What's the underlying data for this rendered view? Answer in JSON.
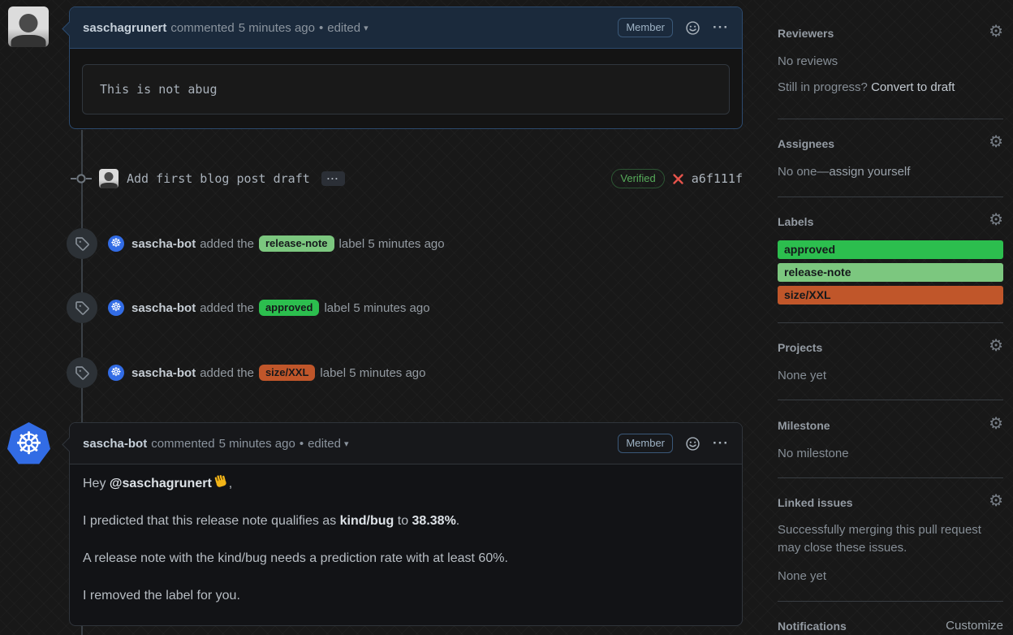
{
  "icons": {
    "kebab": "···",
    "gear": "⚙",
    "dropdown": "▾",
    "dot": "•",
    "wheel": "☸",
    "expand": "···"
  },
  "comment1": {
    "author": "saschagrunert",
    "action": "commented",
    "time": "5 minutes ago",
    "edited": "edited",
    "member_label": "Member",
    "code_text": "This is not abug"
  },
  "commit": {
    "message": "Add first blog post draft",
    "verified_label": "Verified",
    "sha": "a6f111f"
  },
  "events": [
    {
      "actor": "sascha-bot",
      "action": "added the",
      "label": "release-note",
      "label_color": "#7cc77f",
      "suffix": "label 5 minutes ago"
    },
    {
      "actor": "sascha-bot",
      "action": "added the",
      "label": "approved",
      "label_color": "#2cbe4e",
      "suffix": "label 5 minutes ago"
    },
    {
      "actor": "sascha-bot",
      "action": "added the",
      "label": "size/XXL",
      "label_color": "#c0562a",
      "suffix": "label 5 minutes ago"
    }
  ],
  "comment2": {
    "author": "sascha-bot",
    "action": "commented",
    "time": "5 minutes ago",
    "edited": "edited",
    "member_label": "Member",
    "p1_prefix": "Hey ",
    "p1_mention": "@saschagrunert",
    "p1_suffix": ",",
    "p2_prefix": "I predicted that this release note qualifies as ",
    "p2_bold1": "kind/bug",
    "p2_mid": " to ",
    "p2_bold2": "38.38%",
    "p2_suffix": ".",
    "p3": "A release note with the kind/bug needs a prediction rate with at least 60%.",
    "p4": "I removed the label for you."
  },
  "sidebar": {
    "reviewers": {
      "title": "Reviewers",
      "empty": "No reviews",
      "hint_prefix": "Still in progress? ",
      "hint_link": "Convert to draft"
    },
    "assignees": {
      "title": "Assignees",
      "empty_prefix": "No one—",
      "empty_link": "assign yourself"
    },
    "labels": {
      "title": "Labels",
      "items": [
        {
          "name": "approved",
          "color": "#2cbe4e"
        },
        {
          "name": "release-note",
          "color": "#7cc77f"
        },
        {
          "name": "size/XXL",
          "color": "#c0562a"
        }
      ]
    },
    "projects": {
      "title": "Projects",
      "empty": "None yet"
    },
    "milestone": {
      "title": "Milestone",
      "empty": "No milestone"
    },
    "linked_issues": {
      "title": "Linked issues",
      "description": "Successfully merging this pull request may close these issues.",
      "empty": "None yet"
    },
    "notifications": {
      "title": "Notifications",
      "customize": "Customize"
    }
  }
}
